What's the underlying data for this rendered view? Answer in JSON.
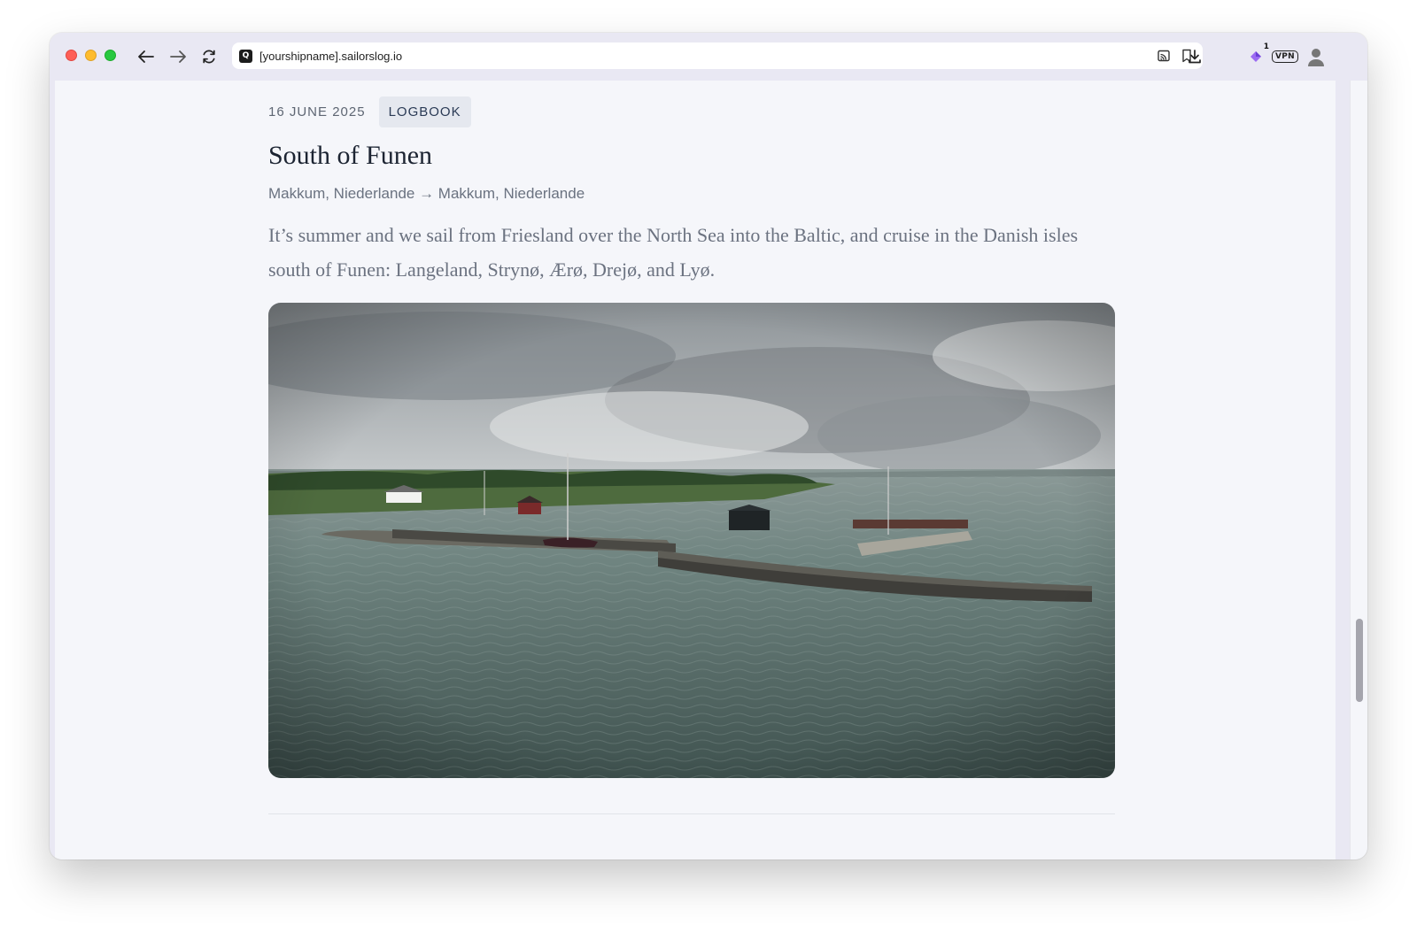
{
  "browser": {
    "url": "[yourshipname].sailorslog.io",
    "favicon_letter": "Q",
    "extension_badge_count": "1",
    "vpn_label": "VPN",
    "icons": {
      "back": "arrow-left-icon",
      "forward": "arrow-right-icon",
      "reload": "reload-icon",
      "cast": "cast-icon",
      "bookmark": "bookmark-icon",
      "download": "download-icon",
      "extension": "diamond-extension-icon",
      "profile": "profile-avatar-icon"
    }
  },
  "post": {
    "date": "16 JUNE 2025",
    "category": "LOGBOOK",
    "title": "South of Funen",
    "route": "Makkum, Niederlande → Makkum, Niederlande",
    "summary": "It’s summer and we sail from Friesland over the North Sea into the Baltic, and cruise in the Danish isles south of Funen: Langeland, Strynø, Ærø, Drejø, and Lyø."
  },
  "colors": {
    "page_background": "#f5f6fa",
    "tag_background": "#e5e8ef",
    "title_color": "#1c2432",
    "body_text": "#6b7280"
  }
}
